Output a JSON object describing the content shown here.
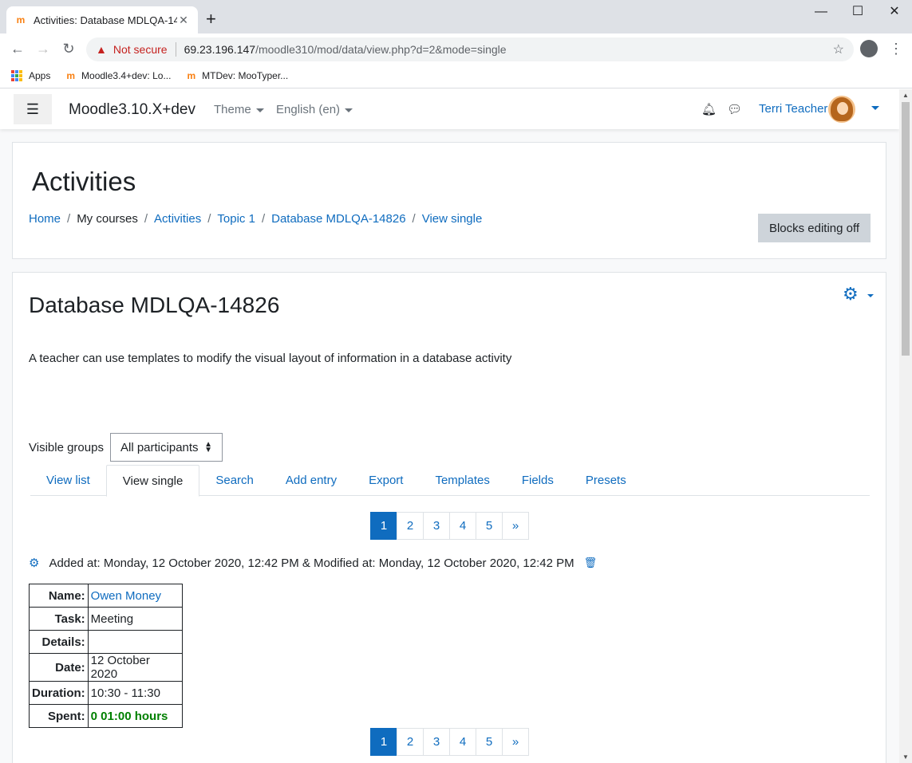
{
  "browser": {
    "tab_title": "Activities: Database MDLQA-148...",
    "tab_close": "✕",
    "new_tab": "+",
    "window": {
      "minimize": "—",
      "maximize": "☐",
      "close": "✕"
    },
    "not_secure": "Not secure",
    "url_host": "69.23.196.147",
    "url_path": "/moodle310/mod/data/view.php?d=2&mode=single",
    "bookmarks": [
      {
        "label": "Apps",
        "icon": "apps-grid-icon"
      },
      {
        "label": "Moodle3.4+dev: Lo...",
        "icon": "moodle-icon"
      },
      {
        "label": "MTDev: MooTyper...",
        "icon": "moodle-icon"
      }
    ]
  },
  "navbar": {
    "site_name": "Moodle3.10.X+dev",
    "theme_label": "Theme",
    "language_label": "English (en)",
    "user_name": "Terri Teacher"
  },
  "header": {
    "title": "Activities",
    "breadcrumb": [
      {
        "label": "Home",
        "link": true
      },
      {
        "label": "My courses",
        "link": false
      },
      {
        "label": "Activities",
        "link": true
      },
      {
        "label": "Topic 1",
        "link": true
      },
      {
        "label": "Database MDLQA-14826",
        "link": true
      },
      {
        "label": "View single",
        "link": true
      }
    ],
    "blocks_button": "Blocks editing off"
  },
  "activity": {
    "title": "Database MDLQA-14826",
    "intro": "A teacher can use templates to modify the visual layout of information in a database activity",
    "visible_groups_label": "Visible groups",
    "visible_groups_value": "All participants",
    "tabs": [
      {
        "label": "View list",
        "active": false
      },
      {
        "label": "View single",
        "active": true
      },
      {
        "label": "Search",
        "active": false
      },
      {
        "label": "Add entry",
        "active": false
      },
      {
        "label": "Export",
        "active": false
      },
      {
        "label": "Templates",
        "active": false
      },
      {
        "label": "Fields",
        "active": false
      },
      {
        "label": "Presets",
        "active": false
      }
    ],
    "pager": [
      "1",
      "2",
      "3",
      "4",
      "5",
      "»"
    ],
    "pager_active": "1",
    "entry_meta": "Added at: Monday, 12 October 2020, 12:42 PM & Modified at: Monday, 12 October 2020, 12:42 PM",
    "entry": {
      "name_label": "Name:",
      "name_value": "Owen Money",
      "task_label": "Task:",
      "task_value": "Meeting",
      "details_label": "Details:",
      "details_value": "",
      "date_label": "Date:",
      "date_value": "12 October 2020",
      "duration_label": "Duration:",
      "duration_value": "10:30 - 11:30",
      "spent_label": "Spent:",
      "spent_value": "0 01:00 hours"
    }
  },
  "colors": {
    "link": "#0f6cbf",
    "spent": "#008000",
    "not_secure": "#c5221f"
  }
}
